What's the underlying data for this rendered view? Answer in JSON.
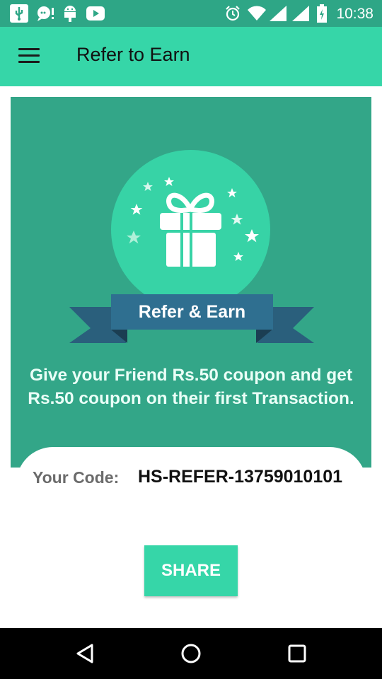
{
  "status_bar": {
    "time": "10:38",
    "icons": [
      "usb-icon",
      "chat-notification-icon",
      "android-debug-icon",
      "youtube-icon",
      "alarm-icon",
      "wifi-icon",
      "signal-icon",
      "signal-icon-2",
      "battery-charging-icon"
    ],
    "color": "#2ea686"
  },
  "app_bar": {
    "title": "Refer to Earn",
    "menu_icon": "hamburger-menu-icon",
    "color": "#36d6a8"
  },
  "hero": {
    "illustration_icon": "gift-box-icon",
    "ribbon_label": "Refer & Earn",
    "offer_text": "Give your Friend Rs.50 coupon and get Rs.50 coupon on their first Transaction.",
    "card_color": "#33a688",
    "circle_color": "#37d3a6",
    "ribbon_color": "#2b6e8e"
  },
  "code": {
    "label": "Your Code:",
    "value": "HS-REFER-13759010101"
  },
  "share": {
    "label": "SHARE"
  },
  "nav_bar": {
    "back_icon": "back-triangle-icon",
    "home_icon": "home-circle-icon",
    "recents_icon": "recents-square-icon"
  }
}
